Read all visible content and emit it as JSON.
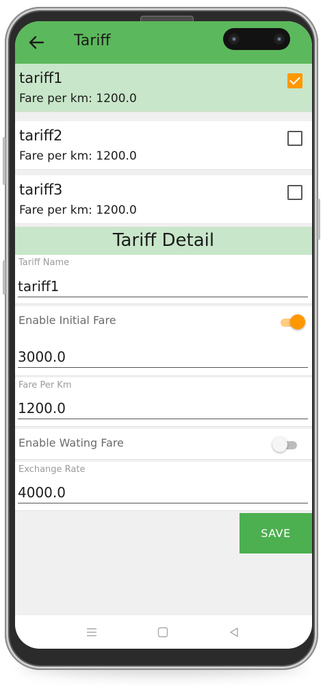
{
  "appbar": {
    "title": "Tariff",
    "color": "#5cb85c"
  },
  "tariffs": [
    {
      "name": "tariff1",
      "fare": "Fare per km: 1200.0",
      "checked": true
    },
    {
      "name": "tariff2",
      "fare": "Fare per km: 1200.0",
      "checked": false
    },
    {
      "name": "tariff3",
      "fare": "Fare per km: 1200.0",
      "checked": false
    }
  ],
  "detail": {
    "header": "Tariff Detail",
    "tariff_name": {
      "label": "Tariff Name",
      "value": "tariff1"
    },
    "initial_fare": {
      "label": "Enable Initial Fare",
      "enabled": true,
      "value": "3000.0"
    },
    "fare_per_km": {
      "label": "Fare Per Km",
      "value": "1200.0"
    },
    "waiting_fare": {
      "label": "Enable Wating Fare",
      "enabled": false
    },
    "exchange_rate": {
      "label": "Exchange Rate",
      "value": "4000.0"
    }
  },
  "save_label": "SAVE",
  "colors": {
    "accent": "#ff9800",
    "selected_bg": "#c8e6c9",
    "save_button": "#4caf50"
  },
  "nav_icons": [
    "menu-icon",
    "home-square-icon",
    "back-triangle-icon"
  ]
}
